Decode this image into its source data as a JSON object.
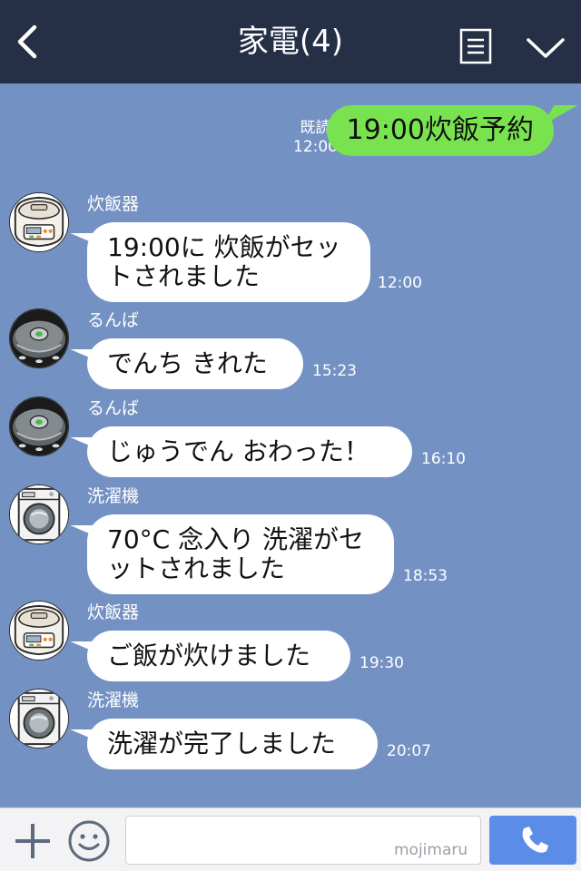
{
  "header": {
    "title": "家電(4)",
    "back_icon": "chevron-left-icon",
    "menu_icon": "notes-icon",
    "collapse_icon": "chevron-down-icon",
    "background": "#253047"
  },
  "chat": {
    "background": "#7392c3",
    "outgoing": {
      "read_label": "既読",
      "time": "12:00",
      "text": "19:00炊飯予約",
      "bubble_color": "#79e34f"
    },
    "messages": [
      {
        "sender": "炊飯器",
        "avatar": "rice-cooker-avatar",
        "lines": [
          "19:00に 炊飯がセッ",
          "トされました"
        ],
        "time": "12:00"
      },
      {
        "sender": "るんば",
        "avatar": "robot-vacuum-avatar",
        "lines": [
          "でんち きれた"
        ],
        "time": "15:23"
      },
      {
        "sender": "るんば",
        "avatar": "robot-vacuum-avatar",
        "lines": [
          "じゅうでん おわった！"
        ],
        "time": "16:10"
      },
      {
        "sender": "洗濯機",
        "avatar": "washing-machine-avatar",
        "lines": [
          "70°C 念入り 洗濯がセ",
          "ットされました"
        ],
        "time": "18:53"
      },
      {
        "sender": "炊飯器",
        "avatar": "rice-cooker-avatar",
        "lines": [
          "ご飯が炊けました"
        ],
        "time": "19:30"
      },
      {
        "sender": "洗濯機",
        "avatar": "washing-machine-avatar",
        "lines": [
          "洗濯が完了しました"
        ],
        "time": "20:07"
      }
    ]
  },
  "input_bar": {
    "add_icon": "plus-icon",
    "emoji_icon": "smiley-icon",
    "text_value": "",
    "placeholder": "",
    "watermark": "mojimaru",
    "send_icon": "phone-icon",
    "send_color": "#5b8de8"
  }
}
